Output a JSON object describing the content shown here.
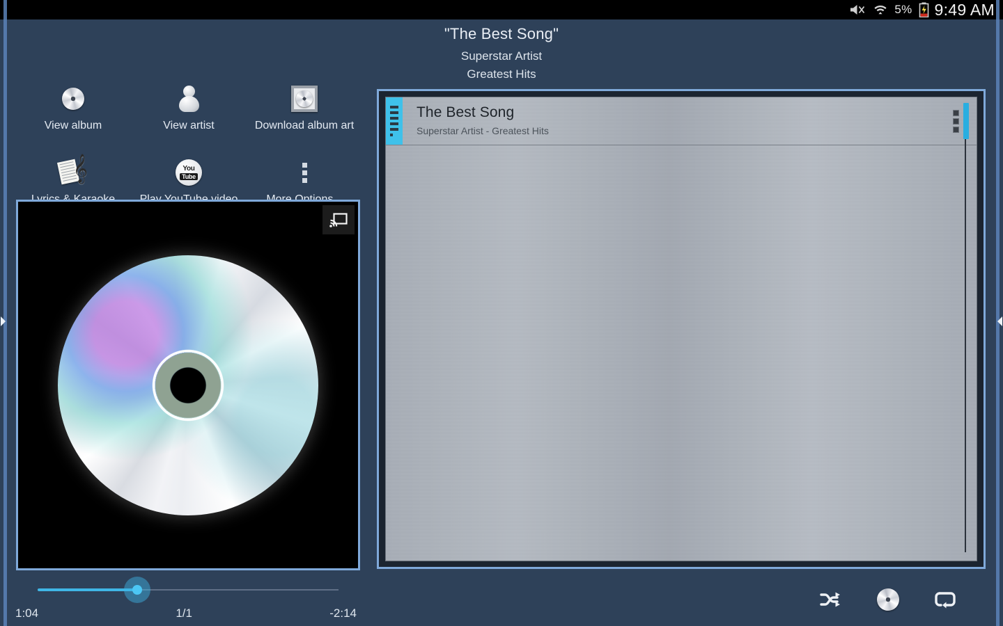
{
  "statusbar": {
    "mute_icon": "speaker-muted-icon",
    "wifi_icon": "wifi-icon",
    "battery_percent": "5%",
    "battery_icon": "battery-charging-icon",
    "clock": "9:49 AM"
  },
  "header": {
    "title": "\"The Best Song\"",
    "artist": "Superstar Artist",
    "album": "Greatest Hits"
  },
  "options": {
    "row1": [
      {
        "label": "View album",
        "icon": "cd-disc-icon"
      },
      {
        "label": "View artist",
        "icon": "person-icon"
      },
      {
        "label": "Download album art",
        "icon": "framed-album-art-icon"
      }
    ],
    "row2": [
      {
        "label": "Lyrics & Karaoke",
        "icon": "sheet-music-icon"
      },
      {
        "label": "Play YouTube video",
        "icon": "youtube-icon"
      },
      {
        "label": "More Options...",
        "icon": "overflow-menu-icon"
      }
    ]
  },
  "album_art": {
    "image": "cd-disc-album-art",
    "cast_button_icon": "chromecast-icon"
  },
  "seekbar": {
    "elapsed": "1:04",
    "track_position": "1/1",
    "remaining": "-2:14",
    "progress_percent": 32,
    "accent_color": "#3fb6e6"
  },
  "playlist": {
    "scrollbar": "playlist-scrollbar",
    "rows": [
      {
        "title": "The Best Song",
        "subtitle": "Superstar Artist - Greatest Hits",
        "grip_icon": "drag-handle-icon",
        "menu_icon": "overflow-menu-icon"
      }
    ]
  },
  "transport": {
    "shuffle_icon": "shuffle-icon",
    "disc_icon": "cd-disc-icon",
    "repeat_icon": "repeat-icon"
  },
  "drawers": {
    "left_icon": "drawer-open-left-icon",
    "right_icon": "drawer-open-right-icon"
  },
  "theme": {
    "background": "#2e4159",
    "accent": "#3fb6e6",
    "panel_border": "#7fa9da"
  }
}
